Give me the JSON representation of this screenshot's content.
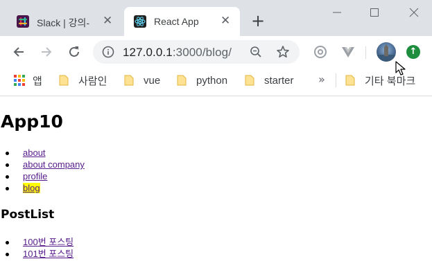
{
  "browser": {
    "tabs": [
      {
        "title": "Slack | 강의-",
        "active": false,
        "close": "✕"
      },
      {
        "title": "React App",
        "active": true,
        "close": "✕"
      }
    ],
    "new_tab_label": "+",
    "address": {
      "host": "127.0.0.1",
      "rest": ":3000/blog/"
    },
    "bookmarks": [
      {
        "label": "앱",
        "icon": "apps-grid-icon"
      },
      {
        "label": "사람인",
        "icon": "folder-icon"
      },
      {
        "label": "vue",
        "icon": "folder-icon"
      },
      {
        "label": "python",
        "icon": "folder-icon"
      },
      {
        "label": "starter",
        "icon": "folder-icon"
      },
      {
        "label": "기타 북마크",
        "icon": "folder-icon"
      }
    ],
    "bookmarks_overflow": "»",
    "update_badge": "↑",
    "colors": {
      "tabstrip": "#dee1e6",
      "omnibox": "#f1f3f4",
      "link": "#551a8b",
      "active_highlight": "#ffff00",
      "update": "#1e8e3e"
    }
  },
  "page": {
    "title": "App10",
    "nav": [
      {
        "label": "about",
        "active": false
      },
      {
        "label": "about company",
        "active": false
      },
      {
        "label": "profile",
        "active": false
      },
      {
        "label": "blog",
        "active": true
      }
    ],
    "postlist_heading": "PostList",
    "posts": [
      "100번 포스팅",
      "101번 포스팅"
    ]
  }
}
